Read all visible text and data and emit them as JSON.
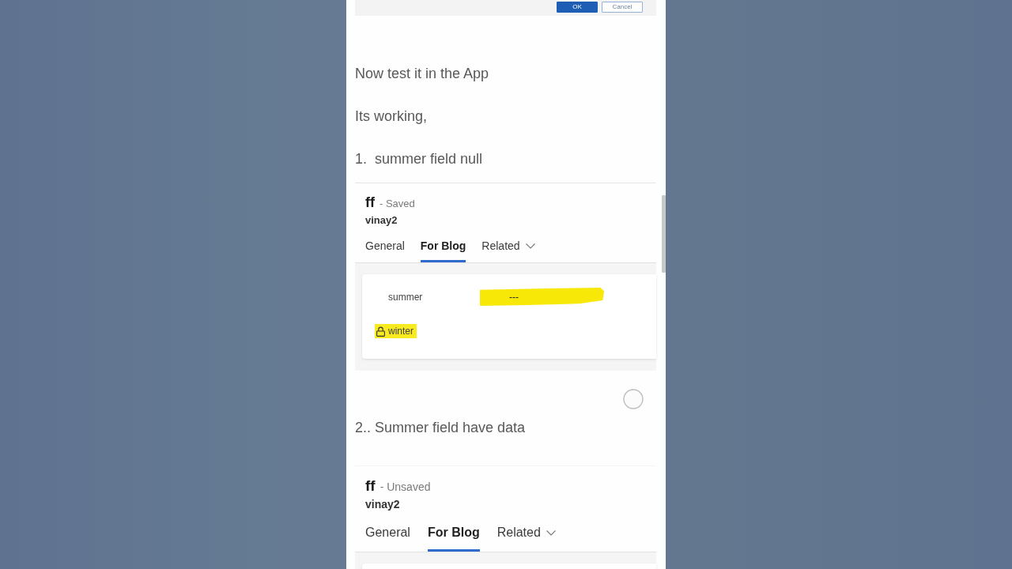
{
  "dialog_footer": {
    "buttons": [
      {
        "label": "OK",
        "kind": "primary"
      },
      {
        "label": "Cancel",
        "kind": "secondary"
      }
    ]
  },
  "blocks": [
    {
      "kind": "text",
      "text": "Now test it in the App"
    },
    {
      "kind": "text",
      "text": "Its working,"
    },
    {
      "kind": "text",
      "text": "1.  summer field null"
    },
    {
      "kind": "form",
      "record": "ff",
      "status": "- Saved",
      "owner": "vinay2",
      "tabs": [
        {
          "label": "General",
          "selected": false,
          "dropdown": false
        },
        {
          "label": "For Blog",
          "selected": true,
          "dropdown": false
        },
        {
          "label": "Related",
          "selected": false,
          "dropdown": true
        }
      ],
      "fields": [
        {
          "label": "summer",
          "label_highlighted": false,
          "locked": false,
          "value": "---",
          "value_highlighted": true
        },
        {
          "label": "winter",
          "label_highlighted": true,
          "locked": true
        }
      ]
    },
    {
      "kind": "text",
      "text": "2.. Summer field have data"
    },
    {
      "kind": "form",
      "record": "ff",
      "status": "- Unsaved",
      "owner": "vinay2",
      "tabs": [
        {
          "label": "General",
          "selected": false,
          "dropdown": false
        },
        {
          "label": "For Blog",
          "selected": true,
          "dropdown": false
        },
        {
          "label": "Related",
          "selected": false,
          "dropdown": true
        }
      ]
    }
  ]
}
